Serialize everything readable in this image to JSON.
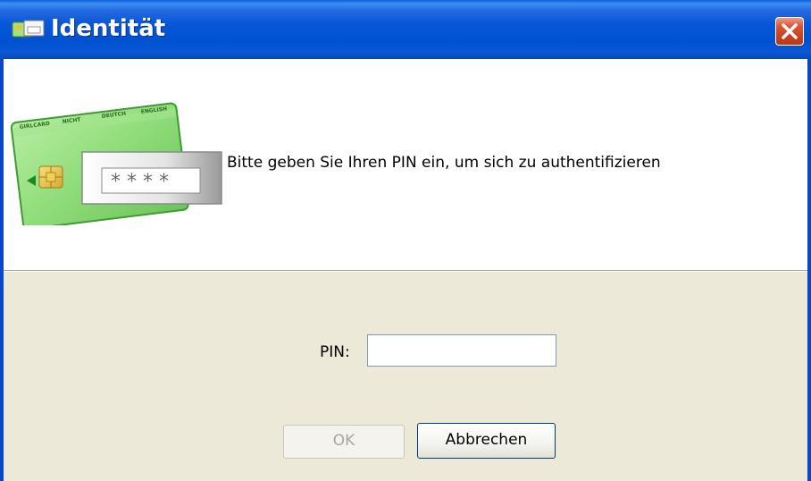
{
  "window": {
    "title": "Identität",
    "app_icon": "smartcard-icon",
    "close_icon": "close-icon",
    "close_label": "Close"
  },
  "header": {
    "illustration": "smartcard-pin-illustration",
    "card_slot_labels": [
      "GIRLCARD",
      "NICHT",
      "DEUTCH",
      "ENGLISH"
    ],
    "pin_mask": "* * * *",
    "instruction": "Bitte geben Sie Ihren PIN ein, um sich zu authentifizieren"
  },
  "form": {
    "pin_label": "PIN:",
    "pin_value": "",
    "pin_placeholder": ""
  },
  "buttons": {
    "ok_label": "OK",
    "ok_enabled": false,
    "cancel_label": "Abbrechen"
  },
  "colors": {
    "titlebar": "#0052d0",
    "close_button": "#c8401e",
    "dialog_background": "#ece9d8",
    "header_background": "#ffffff",
    "card_green": "#8fdc7a"
  }
}
